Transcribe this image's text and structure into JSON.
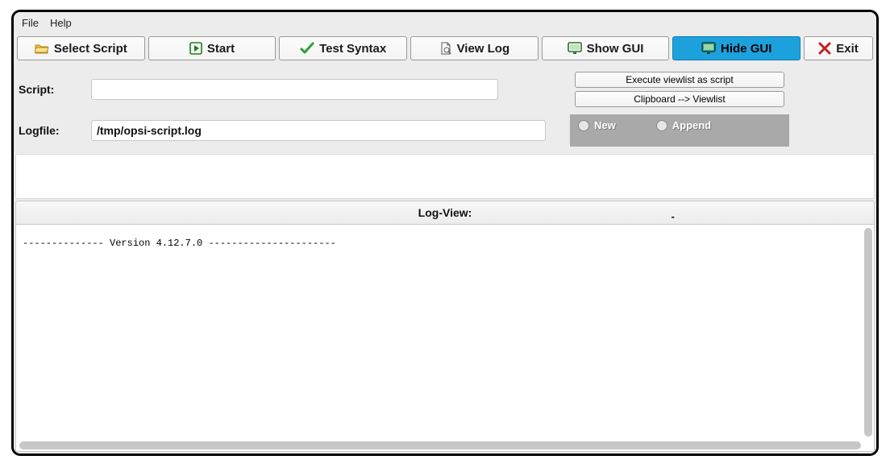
{
  "menu": {
    "file": "File",
    "help": "Help"
  },
  "toolbar": {
    "select_script": "Select Script",
    "start": "Start",
    "test_syntax": "Test Syntax",
    "view_log": "View Log",
    "show_gui": "Show GUI",
    "hide_gui": "Hide GUI",
    "exit": "Exit"
  },
  "labels": {
    "script": "Script:",
    "logfile": "Logfile:",
    "log_view": "Log-View:",
    "dash": "-"
  },
  "script": {
    "value": ""
  },
  "logfile": {
    "value": "/tmp/opsi-script.log"
  },
  "side": {
    "execute_viewlist": "Execute viewlist as script",
    "clipboard_viewlist": "Clipboard --> Viewlist"
  },
  "radios": {
    "new": "New",
    "append": "Append"
  },
  "log_content": "-------------- Version 4.12.7.0 ----------------------"
}
